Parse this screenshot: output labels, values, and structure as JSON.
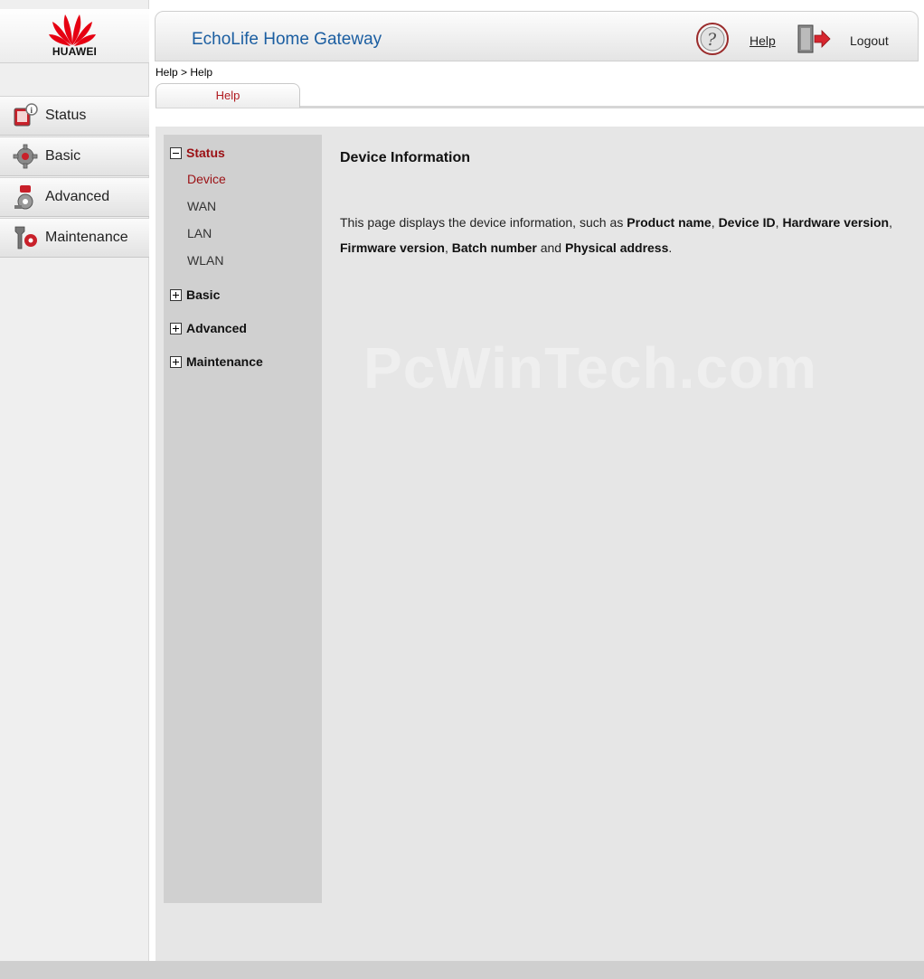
{
  "brand": {
    "logo_text": "HUAWEI",
    "primary_color": "#e60012",
    "title_color": "#1b5ea1",
    "accent_color": "#9b1014"
  },
  "sidebar": {
    "items": [
      {
        "label": "Status",
        "icon": "status-monitor-icon"
      },
      {
        "label": "Basic",
        "icon": "gear-icon"
      },
      {
        "label": "Advanced",
        "icon": "advanced-tools-icon"
      },
      {
        "label": "Maintenance",
        "icon": "wrench-icon"
      }
    ]
  },
  "header": {
    "title": "EchoLife Home Gateway",
    "help_label": "Help",
    "logout_label": "Logout"
  },
  "breadcrumb": "Help > Help",
  "tabs": [
    {
      "label": "Help"
    }
  ],
  "help_tree": {
    "groups": [
      {
        "label": "Status",
        "expanded": true,
        "items": [
          "Device",
          "WAN",
          "LAN",
          "WLAN"
        ],
        "active_item": "Device"
      },
      {
        "label": "Basic",
        "expanded": false
      },
      {
        "label": "Advanced",
        "expanded": false
      },
      {
        "label": "Maintenance",
        "expanded": false
      }
    ]
  },
  "doc": {
    "title": "Device Information",
    "text_1": "This page displays the device information, such as ",
    "bold_1": "Product name",
    "sep_1": ", ",
    "bold_2": "Device ID",
    "sep_2": ", ",
    "bold_3": "Hardware version",
    "sep_3": ", ",
    "bold_4": "Firmware version",
    "sep_4": ", ",
    "bold_5": "Batch number",
    "sep_5": " and ",
    "bold_6": "Physical address",
    "text_end": "."
  },
  "watermark": "PcWinTech.com"
}
